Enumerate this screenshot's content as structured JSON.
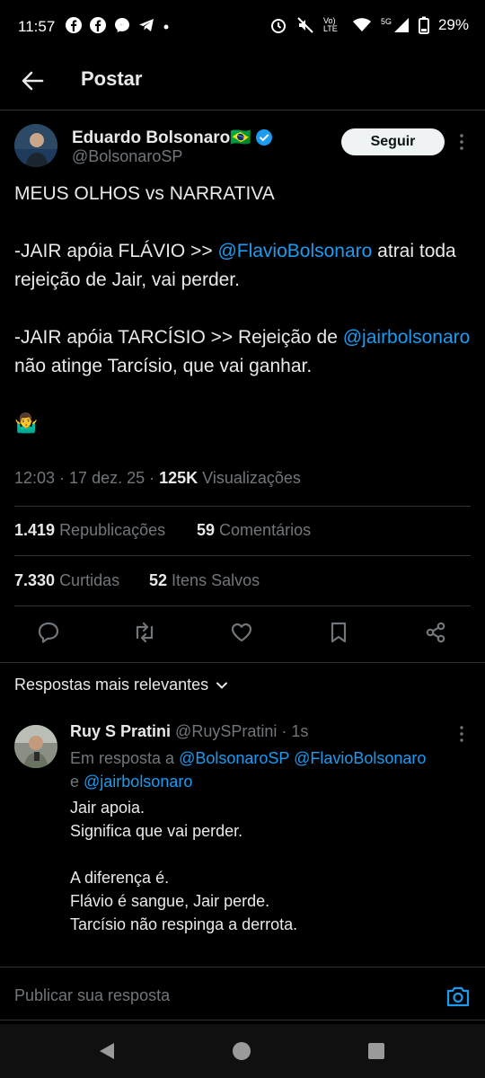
{
  "status_bar": {
    "time": "11:57",
    "battery": "29%",
    "network": "5G",
    "lte": "Vo) LTE"
  },
  "header": {
    "title": "Postar"
  },
  "tweet": {
    "author_name": "Eduardo Bolsonaro🇧🇷",
    "handle": "@BolsonaroSP",
    "follow_label": "Seguir",
    "line1": "MEUS OLHOS vs NARRATIVA",
    "line2_a": "-JAIR apóia FLÁVIO >> ",
    "line2_mention": "@FlavioBolsonaro",
    "line2_b": " atrai toda rejeição de Jair, vai perder.",
    "line3_a": "-JAIR apóia TARCÍSIO >> Rejeição de ",
    "line3_mention": "@jairbolsonaro",
    "line3_b": " não atinge Tarcísio, que vai ganhar.",
    "emoji": "🤷‍♂️",
    "time": "12:03 · 17 dez. 25 · ",
    "views_count": "125K",
    "views_label": " Visualizações"
  },
  "stats": {
    "reposts_count": "1.419",
    "reposts_label": "Republicações",
    "comments_count": "59",
    "comments_label": "Comentários",
    "likes_count": "7.330",
    "likes_label": "Curtidas",
    "saves_count": "52",
    "saves_label": "Itens Salvos"
  },
  "replies_section": {
    "label": "Respostas mais relevantes"
  },
  "reply": {
    "author_name": "Ruy S Pratini",
    "handle_time": "@RuySPratini · 1s",
    "in_reply_prefix": "Em resposta a ",
    "in_reply_mentions": "@BolsonaroSP @FlavioBolsonaro",
    "in_reply_and": "e ",
    "in_reply_last": "@jairbolsonaro",
    "text": "Jair apoia.\nSignifica que vai perder.\n\nA diferença é.\nFlávio é sangue, Jair perde.\nTarcísio não respinga a derrota."
  },
  "compose": {
    "placeholder": "Publicar sua resposta"
  },
  "icons": {
    "verified_color": "#1d9bf0",
    "mention_color": "#1d9bf0"
  }
}
